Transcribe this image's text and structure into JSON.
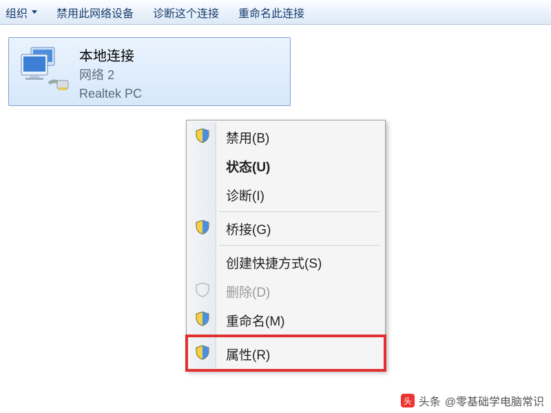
{
  "toolbar": {
    "organize": "组织",
    "disable_device": "禁用此网络设备",
    "diagnose": "诊断这个连接",
    "rename": "重命名此连接"
  },
  "connection": {
    "title": "本地连接",
    "subtitle1": "网络  2",
    "subtitle2": "Realtek PC"
  },
  "menu": {
    "disable": "禁用(B)",
    "status": "状态(U)",
    "diagnose": "诊断(I)",
    "bridge": "桥接(G)",
    "shortcut": "创建快捷方式(S)",
    "delete": "删除(D)",
    "rename": "重命名(M)",
    "properties": "属性(R)"
  },
  "watermark": {
    "prefix": "头条",
    "text": "@零基础学电脑常识"
  }
}
